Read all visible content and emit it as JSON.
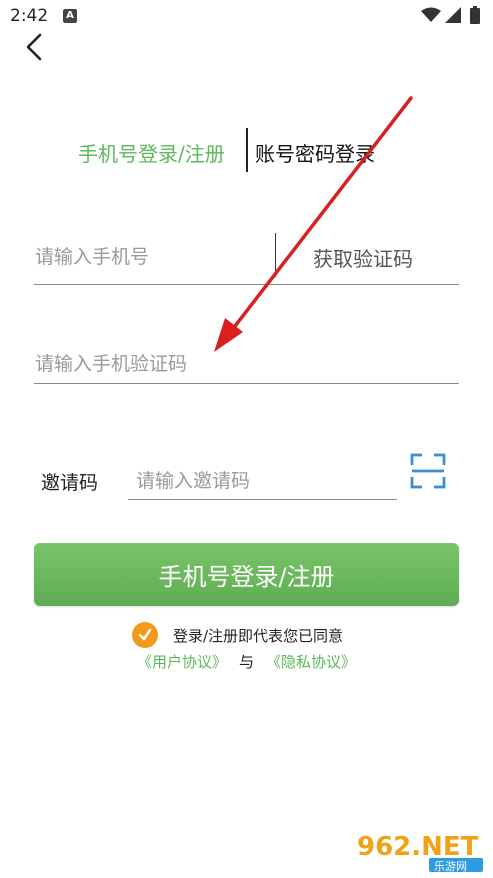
{
  "status_bar": {
    "time": "2:42",
    "app_icon_letter": "A"
  },
  "tabs": {
    "phone_login": "手机号登录/注册",
    "password_login": "账号密码登录"
  },
  "form": {
    "phone_placeholder": "请输入手机号",
    "get_code": "获取验证码",
    "code_placeholder": "请输入手机验证码",
    "invite_label": "邀请码",
    "invite_placeholder": "请输入邀请码"
  },
  "login_button": "手机号登录/注册",
  "agreement": {
    "text": "登录/注册即代表您已同意",
    "user_agreement": "《用户协议》",
    "and": "与",
    "privacy": "《隐私协议》"
  },
  "watermark": {
    "brand": "962.NET",
    "sub": "乐游网"
  },
  "colors": {
    "accent_green": "#5cb85c",
    "button_green": "#6ab95c",
    "check_orange": "#f39a1e",
    "scan_blue": "#3a8fd6",
    "arrow_red": "#d9201f"
  }
}
